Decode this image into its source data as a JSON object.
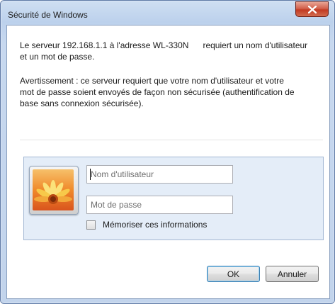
{
  "window": {
    "title": "Sécurité de Windows"
  },
  "message": {
    "line_1": "Le serveur 192.168.1.1 à l'adresse WL-330N",
    "line_1_tail": "requiert un nom d'utilisateur",
    "line_2": "et un mot de passe.",
    "warning_1": "Avertissement : ce serveur requiert que votre nom d'utilisateur et votre",
    "warning_2": "mot de passe soient envoyés de façon non sécurisée (authentification de",
    "warning_3": "base sans connexion sécurisée)."
  },
  "credentials": {
    "username_placeholder": "Nom d'utilisateur",
    "password_placeholder": "Mot de passe",
    "remember_label": "Mémoriser ces informations",
    "remember_checked": false
  },
  "buttons": {
    "ok": "OK",
    "cancel": "Annuler"
  },
  "colors": {
    "accent": "#3c7fb1",
    "close_button": "#c23a22",
    "panel_background": "#e4edf8"
  },
  "icons": {
    "close": "close-icon",
    "user_tile": "flower-user-icon"
  }
}
